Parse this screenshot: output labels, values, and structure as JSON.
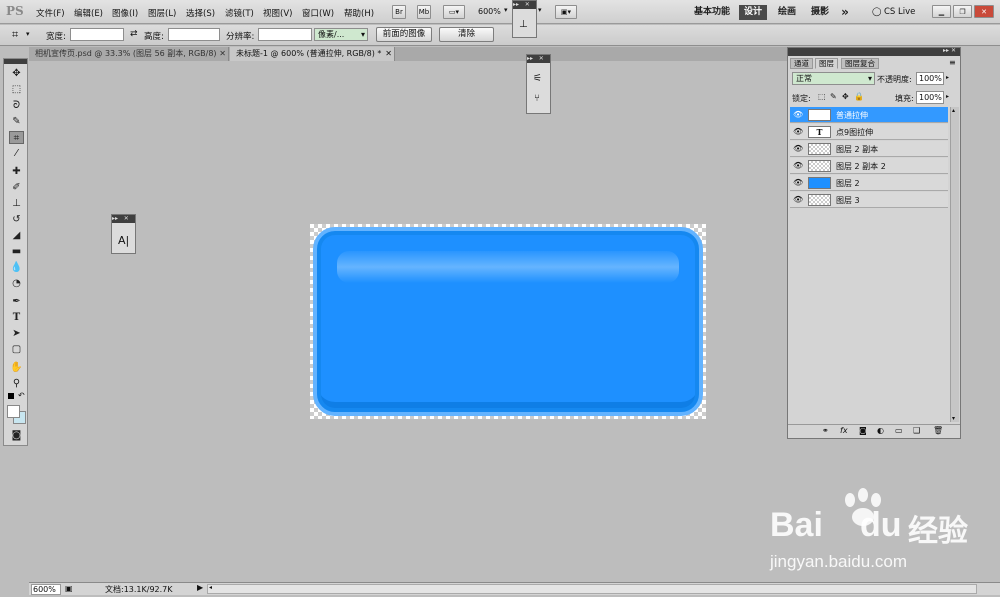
{
  "app": {
    "logo": "PS"
  },
  "menu": [
    "文件(F)",
    "编辑(E)",
    "图像(I)",
    "图层(L)",
    "选择(S)",
    "滤镜(T)",
    "视图(V)",
    "窗口(W)",
    "帮助(H)"
  ],
  "appbar": {
    "br": "Br",
    "mb": "Mb",
    "zoom": "600%"
  },
  "workspaces": {
    "essentials": "基本功能",
    "design": "设计",
    "painting": "绘画",
    "photography": "摄影",
    "more": "»",
    "cslive": "CS Live"
  },
  "options": {
    "width_label": "宽度:",
    "height_label": "高度:",
    "resolution_label": "分辨率:",
    "unit_select": "像素/...",
    "front_image_button": "前面的图像",
    "clear_button": "清除"
  },
  "tabs": [
    {
      "label": "相机宣传页.psd @ 33.3% (图层 56 副本, RGB/8)"
    },
    {
      "label": "未标题-1 @ 600% (普通拉伸, RGB/8) *"
    }
  ],
  "char_panel": {
    "label": "A|"
  },
  "layers_panel": {
    "tabs": [
      "通道",
      "图层",
      "图层复合"
    ],
    "blend_mode": "正常",
    "opacity_label": "不透明度:",
    "opacity_value": "100%",
    "lock_label": "锁定:",
    "fill_label": "填充:",
    "fill_value": "100%",
    "layers": [
      {
        "name": "普通拉伸",
        "thumb": "T",
        "selected": true
      },
      {
        "name": "点9图拉伸",
        "thumb": "T",
        "selected": false
      },
      {
        "name": "图层 2 副本",
        "thumb": "",
        "selected": false
      },
      {
        "name": "图层 2 副本 2",
        "thumb": "",
        "selected": false
      },
      {
        "name": "图层 2",
        "thumb": "",
        "selected": false
      },
      {
        "name": "图层 3",
        "thumb": "",
        "selected": false
      }
    ]
  },
  "status": {
    "zoom": "600%",
    "doc": "文档:13.1K/92.7K"
  },
  "watermark": {
    "brand_left": "Bai",
    "brand_right": "du",
    "cn": "经验",
    "url": "jingyan.baidu.com"
  },
  "colors": {
    "shape_blue": "#1e90ff",
    "selection_blue": "#3399ff"
  }
}
